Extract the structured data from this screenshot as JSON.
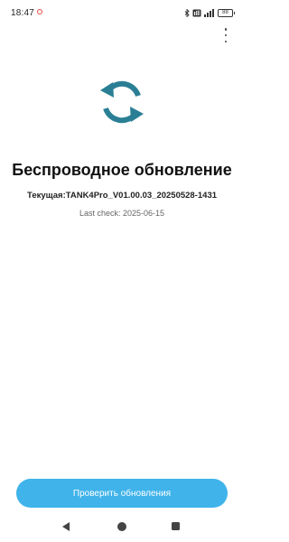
{
  "status_bar": {
    "time": "18:47",
    "battery": "88"
  },
  "page": {
    "title": "Беспроводное обновление",
    "current_version": "Текущая:TANK4Pro_V01.00.03_20250528-1431",
    "last_check": "Last check: 2025-06-15"
  },
  "actions": {
    "check_updates_label": "Проверить обновления"
  },
  "colors": {
    "accent": "#3fb3ea",
    "icon": "#2a7f95",
    "notification_dot": "#e64a3b"
  },
  "icons": {
    "update": "sync-arrows-icon",
    "menu": "more-vert-icon",
    "nav_back": "triangle-back-icon",
    "nav_home": "circle-home-icon",
    "nav_recents": "square-recents-icon"
  }
}
